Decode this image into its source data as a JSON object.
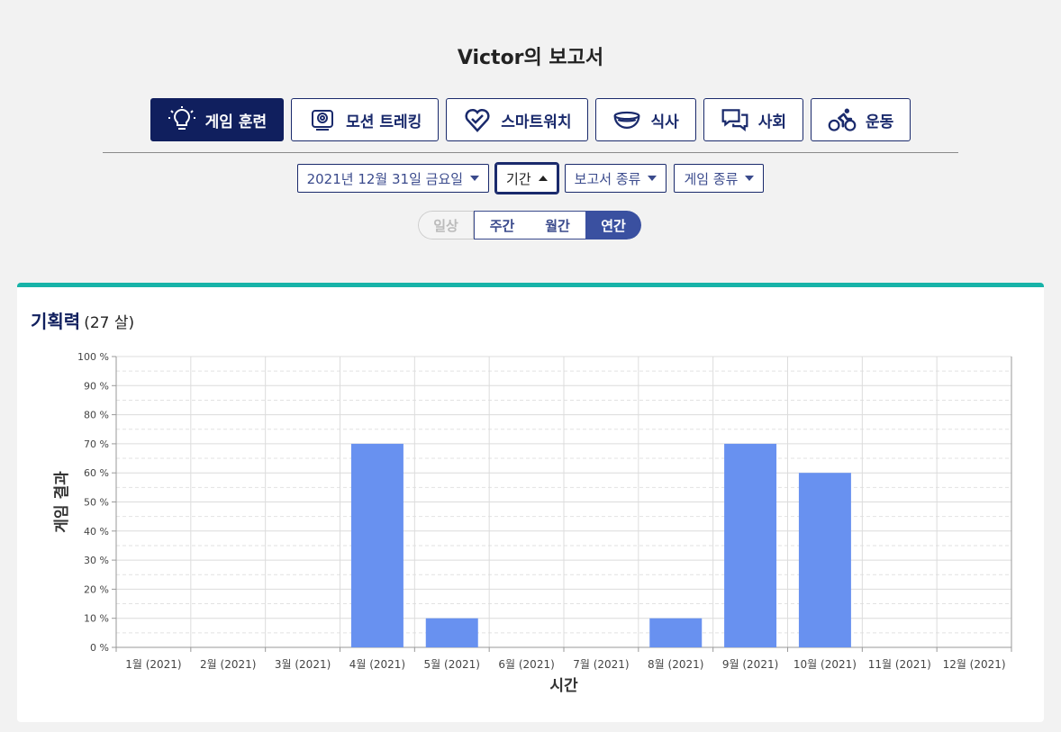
{
  "page": {
    "title": "Victor의 보고서"
  },
  "categories": [
    {
      "label": "게임 훈련",
      "icon": "lightbulb-icon",
      "active": true
    },
    {
      "label": "모션 트레킹",
      "icon": "camera-icon",
      "active": false
    },
    {
      "label": "스마트워치",
      "icon": "heart-icon",
      "active": false
    },
    {
      "label": "식사",
      "icon": "bowl-icon",
      "active": false
    },
    {
      "label": "사회",
      "icon": "chat-icon",
      "active": false
    },
    {
      "label": "운동",
      "icon": "bicycle-icon",
      "active": false
    }
  ],
  "filters": {
    "date": "2021년 12월 31일 금요일",
    "period": "기간",
    "report_type": "보고서 종류",
    "game_type": "게임 종류"
  },
  "period_tabs": [
    {
      "label": "일상",
      "state": "disabled"
    },
    {
      "label": "주간",
      "state": "normal"
    },
    {
      "label": "월간",
      "state": "normal"
    },
    {
      "label": "연간",
      "state": "active"
    }
  ],
  "card": {
    "title": "기획력",
    "subtitle": "(27 살)"
  },
  "colors": {
    "accent": "#17b3a8",
    "bar": "#6891f0",
    "navy": "#101f5e"
  },
  "chart_data": {
    "type": "bar",
    "categories": [
      "1월 (2021)",
      "2월 (2021)",
      "3월 (2021)",
      "4월 (2021)",
      "5월 (2021)",
      "6월 (2021)",
      "7월 (2021)",
      "8월 (2021)",
      "9월 (2021)",
      "10월 (2021)",
      "11월 (2021)",
      "12월 (2021)"
    ],
    "values": [
      0,
      0,
      0,
      70,
      10,
      0,
      0,
      10,
      70,
      60,
      0,
      0
    ],
    "xlabel": "시간",
    "ylabel": "게임 결과",
    "ylim": [
      0,
      100
    ],
    "yticks": [
      "0 %",
      "10 %",
      "20 %",
      "30 %",
      "40 %",
      "50 %",
      "60 %",
      "70 %",
      "80 %",
      "90 %",
      "100 %"
    ],
    "grid": true
  }
}
